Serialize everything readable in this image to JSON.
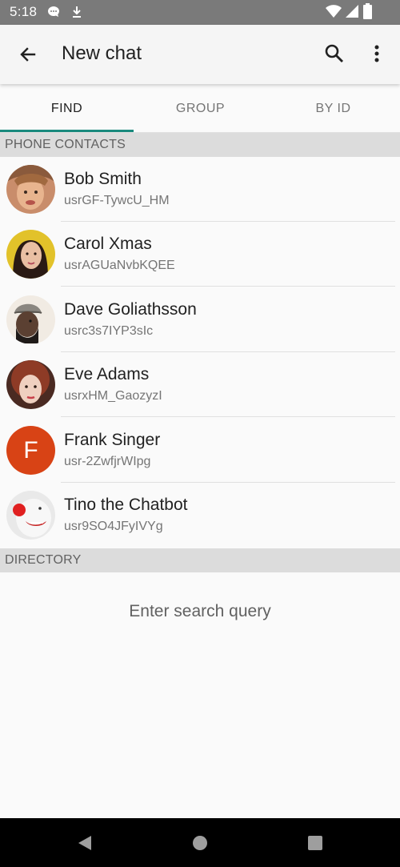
{
  "status_bar": {
    "time": "5:18",
    "left_icons": [
      "chat-bubble-icon",
      "download-icon"
    ],
    "right_icons": [
      "wifi-icon",
      "signal-icon",
      "battery-icon"
    ]
  },
  "appbar": {
    "title": "New chat",
    "back_icon": "arrow-back-icon",
    "search_icon": "search-icon",
    "more_icon": "more-vert-icon"
  },
  "tabs": [
    {
      "label": "FIND",
      "active": true
    },
    {
      "label": "GROUP",
      "active": false
    },
    {
      "label": "BY ID",
      "active": false
    }
  ],
  "accent_color": "#1a8a7d",
  "phone_contacts": {
    "header": "PHONE CONTACTS",
    "items": [
      {
        "name": "Bob Smith",
        "id": "usrGF-TywcU_HM",
        "avatar": "photo"
      },
      {
        "name": "Carol Xmas",
        "id": "usrAGUaNvbKQEE",
        "avatar": "photo"
      },
      {
        "name": "Dave Goliathsson",
        "id": "usrc3s7IYP3sIc",
        "avatar": "photo"
      },
      {
        "name": "Eve Adams",
        "id": "usrxHM_GaozyzI",
        "avatar": "photo"
      },
      {
        "name": "Frank Singer",
        "id": "usr-2ZwfjrWIpg",
        "avatar": "letter",
        "initial": "F",
        "avatar_color": "#d84315"
      },
      {
        "name": "Tino the Chatbot",
        "id": "usr9SO4JFyIVYg",
        "avatar": "photo"
      }
    ]
  },
  "directory": {
    "header": "DIRECTORY",
    "empty_message": "Enter search query"
  },
  "navbar": {
    "icons": [
      "back-triangle-icon",
      "home-circle-icon",
      "recents-square-icon"
    ]
  }
}
